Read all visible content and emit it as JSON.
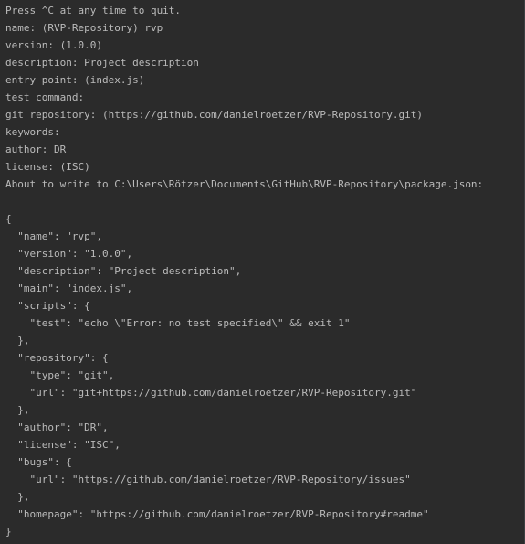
{
  "terminal": {
    "lines": [
      "Press ^C at any time to quit.",
      "name: (RVP-Repository) rvp",
      "version: (1.0.0)",
      "description: Project description",
      "entry point: (index.js)",
      "test command:",
      "git repository: (https://github.com/danielroetzer/RVP-Repository.git)",
      "keywords:",
      "author: DR",
      "license: (ISC)",
      "About to write to C:\\Users\\Rötzer\\Documents\\GitHub\\RVP-Repository\\package.json:",
      "",
      "{",
      "  \"name\": \"rvp\",",
      "  \"version\": \"1.0.0\",",
      "  \"description\": \"Project description\",",
      "  \"main\": \"index.js\",",
      "  \"scripts\": {",
      "    \"test\": \"echo \\\"Error: no test specified\\\" && exit 1\"",
      "  },",
      "  \"repository\": {",
      "    \"type\": \"git\",",
      "    \"url\": \"git+https://github.com/danielroetzer/RVP-Repository.git\"",
      "  },",
      "  \"author\": \"DR\",",
      "  \"license\": \"ISC\",",
      "  \"bugs\": {",
      "    \"url\": \"https://github.com/danielroetzer/RVP-Repository/issues\"",
      "  },",
      "  \"homepage\": \"https://github.com/danielroetzer/RVP-Repository#readme\"",
      "}"
    ],
    "colors": {
      "background": "#2b2b2b",
      "text": "#bbbbbb"
    }
  }
}
